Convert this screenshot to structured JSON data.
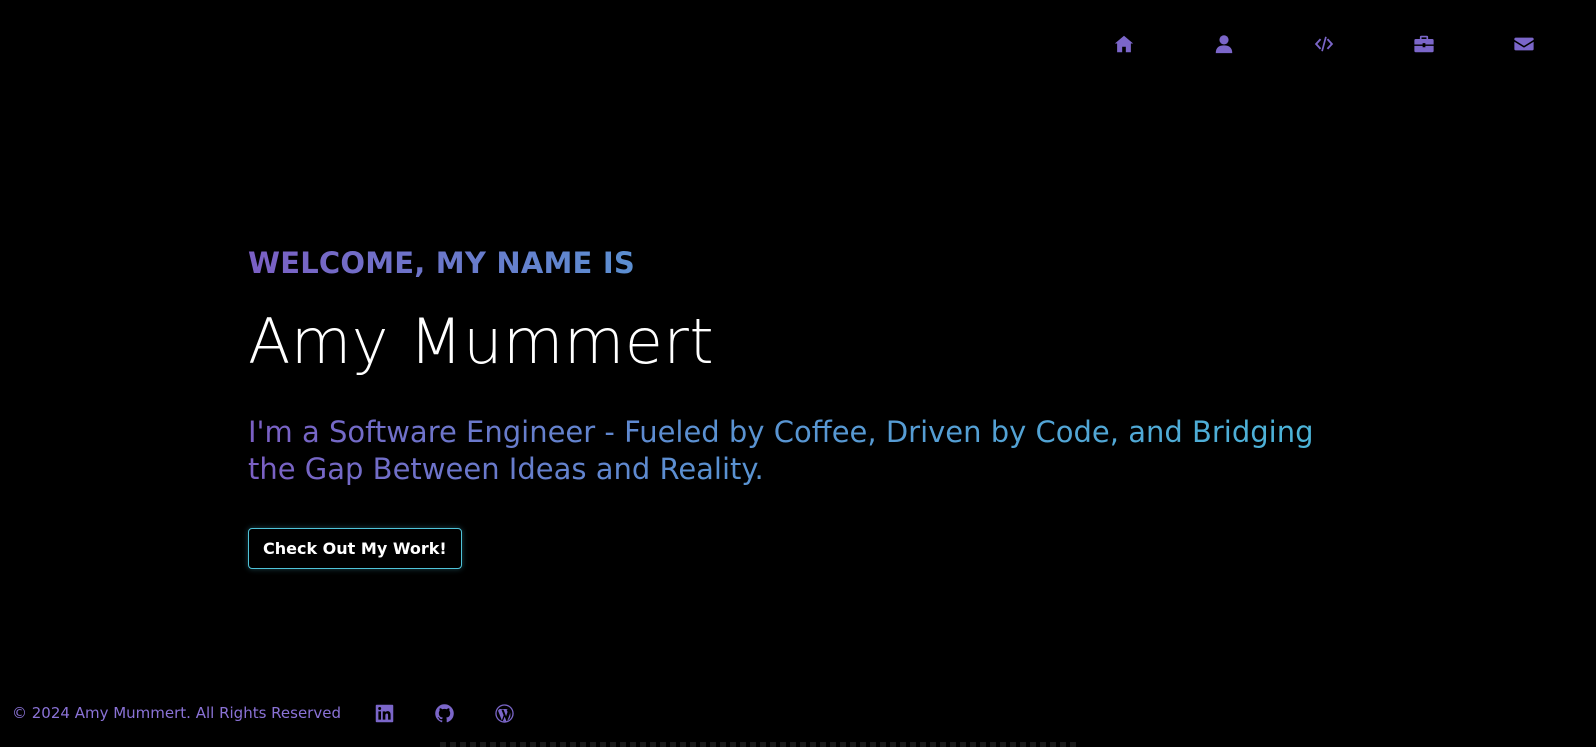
{
  "nav": {
    "items": [
      {
        "icon": "home-icon",
        "label": "Home"
      },
      {
        "icon": "user-icon",
        "label": "About"
      },
      {
        "icon": "code-icon",
        "label": "Skills"
      },
      {
        "icon": "briefcase-icon",
        "label": "Work"
      },
      {
        "icon": "envelope-icon",
        "label": "Contact"
      }
    ]
  },
  "hero": {
    "welcome": "WELCOME, MY NAME IS",
    "name": "Amy Mummert",
    "tagline": "I'm a Software Engineer - Fueled by Coffee, Driven by Code, and Bridging the Gap Between Ideas and Reality.",
    "cta_label": "Check Out My Work!"
  },
  "footer": {
    "copyright": "© 2024 Amy Mummert. All Rights Reserved",
    "social": [
      {
        "icon": "linkedin-icon"
      },
      {
        "icon": "github-icon"
      },
      {
        "icon": "wordpress-icon"
      }
    ]
  },
  "colors": {
    "background": "#000000",
    "icon_purple": "#7b66c9",
    "gradient_start": "#7b5fc4",
    "gradient_mid": "#5b8fd1",
    "gradient_end": "#4bb5d8",
    "button_border": "#4fc3d9"
  }
}
